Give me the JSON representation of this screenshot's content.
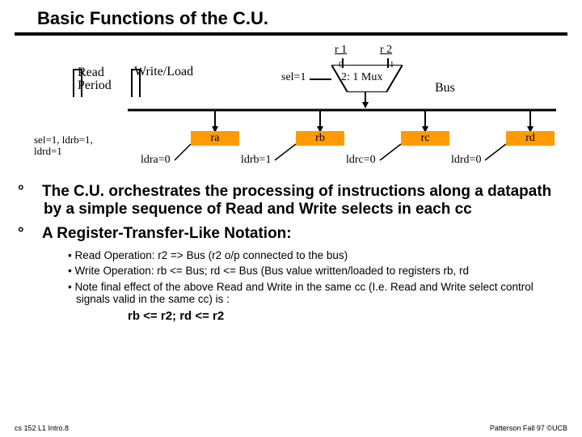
{
  "title": "Basic Functions of the C.U.",
  "diagram": {
    "read_period": "Read\nPeriod",
    "write_load": "Write/Load",
    "r1": "r 1",
    "r2": "r 2",
    "sel": "sel=1",
    "mux": "2: 1 Mux",
    "mux0": "0",
    "mux1": "1",
    "bus": "Bus",
    "ra": "ra",
    "rb": "rb",
    "rc": "rc",
    "rd": "rd",
    "sel_ann": "sel=1, ldrb=1,\nldrd=1",
    "ldra": "ldra=0",
    "ldrb": "ldrb=1",
    "ldrc": "ldrc=0",
    "ldrd": "ldrd=0"
  },
  "bul1": "The C.U. orchestrates the processing of instructions along a datapath by a simple sequence of Read and Write selects in each cc",
  "bul2": "A Register-Transfer-Like Notation:",
  "sub1": "Read Operation: r2 => Bus (r2 o/p connected to the bus)",
  "sub2": "Write Operation: rb <= Bus; rd <= Bus (Bus value written/loaded to registers rb, rd",
  "sub3": "Note final effect of the above Read and Write in the same cc (I.e. Read and Write select control signals valid in the same cc) is :",
  "sub4": "rb <= r2; rd <= r2",
  "footer_left": "cs 152  L1 Intro.8",
  "footer_right": "Patterson Fall 97 ©UCB"
}
